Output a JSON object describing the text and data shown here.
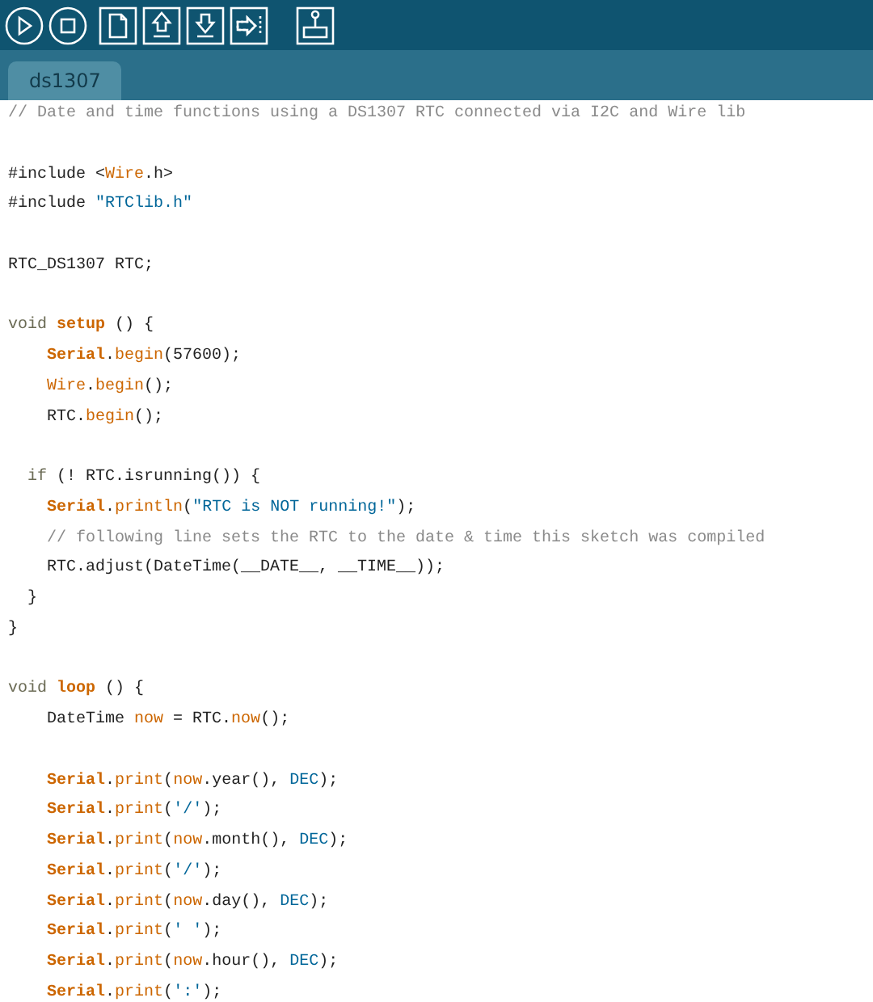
{
  "toolbar": {
    "buttons": [
      {
        "kind": "run"
      },
      {
        "kind": "stop"
      },
      {
        "kind": "new"
      },
      {
        "kind": "open"
      },
      {
        "kind": "save"
      },
      {
        "kind": "upload"
      },
      {
        "kind": "monitor"
      }
    ]
  },
  "tabs": [
    {
      "label": "ds1307",
      "selected": true
    }
  ],
  "editor": {
    "lines": [
      {
        "kind": "code",
        "tokens": [
          {
            "kind": "comment",
            "text": "// Date and time functions using a DS1307 RTC connected via I2C and Wire lib"
          }
        ]
      },
      {
        "kind": "blank"
      },
      {
        "kind": "code",
        "tokens": [
          {
            "kind": "plain",
            "text": "#include <"
          },
          {
            "kind": "function",
            "text": "Wire"
          },
          {
            "kind": "plain",
            "text": ".h>"
          }
        ]
      },
      {
        "kind": "code",
        "tokens": [
          {
            "kind": "plain",
            "text": "#include "
          },
          {
            "kind": "string",
            "text": "\"RTClib.h\""
          }
        ]
      },
      {
        "kind": "blank"
      },
      {
        "kind": "code",
        "tokens": [
          {
            "kind": "plain",
            "text": "RTC_DS1307 RTC;"
          }
        ]
      },
      {
        "kind": "blank"
      },
      {
        "kind": "code",
        "tokens": [
          {
            "kind": "keyword",
            "text": "void "
          },
          {
            "kind": "bold",
            "text": "setup"
          },
          {
            "kind": "plain",
            "text": " () {"
          }
        ]
      },
      {
        "kind": "code",
        "tokens": [
          {
            "kind": "bold",
            "text": "    Serial"
          },
          {
            "kind": "plain",
            "text": "."
          },
          {
            "kind": "function",
            "text": "begin"
          },
          {
            "kind": "plain",
            "text": "(57600);"
          }
        ]
      },
      {
        "kind": "code",
        "tokens": [
          {
            "kind": "function",
            "text": "    Wire"
          },
          {
            "kind": "plain",
            "text": "."
          },
          {
            "kind": "function",
            "text": "begin"
          },
          {
            "kind": "plain",
            "text": "();"
          }
        ]
      },
      {
        "kind": "code",
        "tokens": [
          {
            "kind": "plain",
            "text": "    RTC."
          },
          {
            "kind": "function",
            "text": "begin"
          },
          {
            "kind": "plain",
            "text": "();"
          }
        ]
      },
      {
        "kind": "blank"
      },
      {
        "kind": "code",
        "tokens": [
          {
            "kind": "keyword",
            "text": "  if"
          },
          {
            "kind": "plain",
            "text": " (! RTC.isrunning()) {"
          }
        ]
      },
      {
        "kind": "code",
        "tokens": [
          {
            "kind": "bold",
            "text": "    Serial"
          },
          {
            "kind": "plain",
            "text": "."
          },
          {
            "kind": "function",
            "text": "println"
          },
          {
            "kind": "plain",
            "text": "("
          },
          {
            "kind": "string",
            "text": "\"RTC is NOT running!\""
          },
          {
            "kind": "plain",
            "text": ");"
          }
        ]
      },
      {
        "kind": "code",
        "tokens": [
          {
            "kind": "comment",
            "text": "    // following line sets the RTC to the date & time this sketch was compiled"
          }
        ]
      },
      {
        "kind": "code",
        "tokens": [
          {
            "kind": "plain",
            "text": "    RTC.adjust(DateTime(__DATE__, __TIME__));"
          }
        ]
      },
      {
        "kind": "code",
        "tokens": [
          {
            "kind": "plain",
            "text": "  }"
          }
        ]
      },
      {
        "kind": "code",
        "tokens": [
          {
            "kind": "plain",
            "text": "}"
          }
        ]
      },
      {
        "kind": "blank"
      },
      {
        "kind": "code",
        "tokens": [
          {
            "kind": "keyword",
            "text": "void "
          },
          {
            "kind": "bold",
            "text": "loop"
          },
          {
            "kind": "plain",
            "text": " () {"
          }
        ]
      },
      {
        "kind": "code",
        "tokens": [
          {
            "kind": "plain",
            "text": "    DateTime "
          },
          {
            "kind": "function",
            "text": "now"
          },
          {
            "kind": "plain",
            "text": " = RTC."
          },
          {
            "kind": "function",
            "text": "now"
          },
          {
            "kind": "plain",
            "text": "();"
          }
        ]
      },
      {
        "kind": "blank"
      },
      {
        "kind": "code",
        "tokens": [
          {
            "kind": "bold",
            "text": "    Serial"
          },
          {
            "kind": "plain",
            "text": "."
          },
          {
            "kind": "function",
            "text": "print"
          },
          {
            "kind": "plain",
            "text": "("
          },
          {
            "kind": "function",
            "text": "now"
          },
          {
            "kind": "plain",
            "text": ".year(), "
          },
          {
            "kind": "constant",
            "text": "DEC"
          },
          {
            "kind": "plain",
            "text": ");"
          }
        ]
      },
      {
        "kind": "code",
        "tokens": [
          {
            "kind": "bold",
            "text": "    Serial"
          },
          {
            "kind": "plain",
            "text": "."
          },
          {
            "kind": "function",
            "text": "print"
          },
          {
            "kind": "plain",
            "text": "("
          },
          {
            "kind": "string",
            "text": "'/'"
          },
          {
            "kind": "plain",
            "text": ");"
          }
        ]
      },
      {
        "kind": "code",
        "tokens": [
          {
            "kind": "bold",
            "text": "    Serial"
          },
          {
            "kind": "plain",
            "text": "."
          },
          {
            "kind": "function",
            "text": "print"
          },
          {
            "kind": "plain",
            "text": "("
          },
          {
            "kind": "function",
            "text": "now"
          },
          {
            "kind": "plain",
            "text": ".month(), "
          },
          {
            "kind": "constant",
            "text": "DEC"
          },
          {
            "kind": "plain",
            "text": ");"
          }
        ]
      },
      {
        "kind": "code",
        "tokens": [
          {
            "kind": "bold",
            "text": "    Serial"
          },
          {
            "kind": "plain",
            "text": "."
          },
          {
            "kind": "function",
            "text": "print"
          },
          {
            "kind": "plain",
            "text": "("
          },
          {
            "kind": "string",
            "text": "'/'"
          },
          {
            "kind": "plain",
            "text": ");"
          }
        ]
      },
      {
        "kind": "code",
        "tokens": [
          {
            "kind": "bold",
            "text": "    Serial"
          },
          {
            "kind": "plain",
            "text": "."
          },
          {
            "kind": "function",
            "text": "print"
          },
          {
            "kind": "plain",
            "text": "("
          },
          {
            "kind": "function",
            "text": "now"
          },
          {
            "kind": "plain",
            "text": ".day(), "
          },
          {
            "kind": "constant",
            "text": "DEC"
          },
          {
            "kind": "plain",
            "text": ");"
          }
        ]
      },
      {
        "kind": "code",
        "tokens": [
          {
            "kind": "bold",
            "text": "    Serial"
          },
          {
            "kind": "plain",
            "text": "."
          },
          {
            "kind": "function",
            "text": "print"
          },
          {
            "kind": "plain",
            "text": "("
          },
          {
            "kind": "string",
            "text": "' '"
          },
          {
            "kind": "plain",
            "text": ");"
          }
        ]
      },
      {
        "kind": "code",
        "tokens": [
          {
            "kind": "bold",
            "text": "    Serial"
          },
          {
            "kind": "plain",
            "text": "."
          },
          {
            "kind": "function",
            "text": "print"
          },
          {
            "kind": "plain",
            "text": "("
          },
          {
            "kind": "function",
            "text": "now"
          },
          {
            "kind": "plain",
            "text": ".hour(), "
          },
          {
            "kind": "constant",
            "text": "DEC"
          },
          {
            "kind": "plain",
            "text": ");"
          }
        ]
      },
      {
        "kind": "code",
        "tokens": [
          {
            "kind": "bold",
            "text": "    Serial"
          },
          {
            "kind": "plain",
            "text": "."
          },
          {
            "kind": "function",
            "text": "print"
          },
          {
            "kind": "plain",
            "text": "("
          },
          {
            "kind": "string",
            "text": "':'"
          },
          {
            "kind": "plain",
            "text": ");"
          }
        ]
      }
    ]
  }
}
